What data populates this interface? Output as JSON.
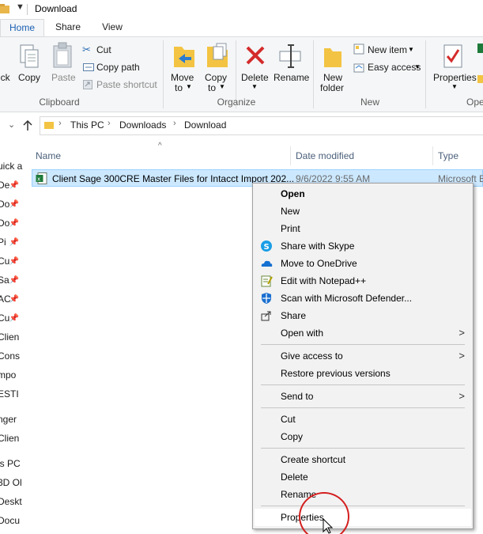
{
  "window": {
    "title": "Download"
  },
  "tabs": [
    {
      "label": "Home"
    },
    {
      "label": "Share"
    },
    {
      "label": "View"
    }
  ],
  "ribbon": {
    "clipboard": {
      "pin_partial": "ick",
      "copy": "Copy",
      "paste": "Paste",
      "cut": "Cut",
      "copy_path": "Copy path",
      "paste_shortcut": "Paste shortcut",
      "group": "Clipboard"
    },
    "organize": {
      "move_to": "Move",
      "move_to_2": "to",
      "copy_to": "Copy",
      "copy_to_2": "to",
      "delete": "Delete",
      "rename": "Rename",
      "group": "Organize"
    },
    "new": {
      "new_folder": "New",
      "new_folder_2": "folder",
      "new_item": "New item",
      "easy_access": "Easy access",
      "group": "New"
    },
    "open": {
      "properties": "Properties",
      "group": "Ope"
    }
  },
  "address": {
    "crumbs": [
      "This PC",
      "Downloads",
      "Download"
    ]
  },
  "nav": {
    "items": [
      {
        "text": "uick a",
        "pinned": false
      },
      {
        "text": "De",
        "pinned": true
      },
      {
        "text": "Do",
        "pinned": true
      },
      {
        "text": "Do",
        "pinned": true
      },
      {
        "text": "Pi",
        "pinned": true
      },
      {
        "text": "Cu",
        "pinned": true
      },
      {
        "text": "Sa",
        "pinned": true
      },
      {
        "text": "AC",
        "pinned": true
      },
      {
        "text": "Cu",
        "pinned": true
      },
      {
        "text": "Clien",
        "pinned": false
      },
      {
        "text": "Cons",
        "pinned": false
      },
      {
        "text": "mpo",
        "pinned": false
      },
      {
        "text": "ESTI",
        "pinned": false
      },
      {
        "text": "nger",
        "pinned": false
      },
      {
        "text": "Clien",
        "pinned": false
      },
      {
        "text": "is PC",
        "pinned": false
      },
      {
        "text": "3D Ol",
        "pinned": false
      },
      {
        "text": "Deskt",
        "pinned": false
      },
      {
        "text": "Docu",
        "pinned": false
      }
    ]
  },
  "columns": {
    "name": "Name",
    "date": "Date modified",
    "type": "Type"
  },
  "files": [
    {
      "name": "Client Sage 300CRE Master Files for Intacct Import 202...",
      "date": "9/6/2022 9:55 AM",
      "type": "Microsoft E"
    }
  ],
  "context_menu": {
    "items": [
      {
        "label": "Open",
        "bold": true
      },
      {
        "label": "New"
      },
      {
        "label": "Print"
      },
      {
        "label": "Share with Skype",
        "icon": "skype-icon"
      },
      {
        "label": "Move to OneDrive",
        "icon": "onedrive-icon"
      },
      {
        "label": "Edit with Notepad++",
        "icon": "notepad-plus-plus-icon"
      },
      {
        "label": "Scan with Microsoft Defender...",
        "icon": "defender-icon"
      },
      {
        "label": "Share",
        "icon": "share-icon"
      },
      {
        "label": "Open with",
        "submenu": true
      },
      {
        "label": "Give access to",
        "submenu": true
      },
      {
        "label": "Restore previous versions"
      },
      {
        "label": "Send to",
        "submenu": true
      },
      {
        "label": "Cut"
      },
      {
        "label": "Copy"
      },
      {
        "label": "Create shortcut"
      },
      {
        "label": "Delete"
      },
      {
        "label": "Rename"
      },
      {
        "label": "Properties"
      }
    ]
  },
  "colors": {
    "accent": "#1a5fb4",
    "selection": "#cce8ff",
    "annotation": "#d41f1f"
  }
}
